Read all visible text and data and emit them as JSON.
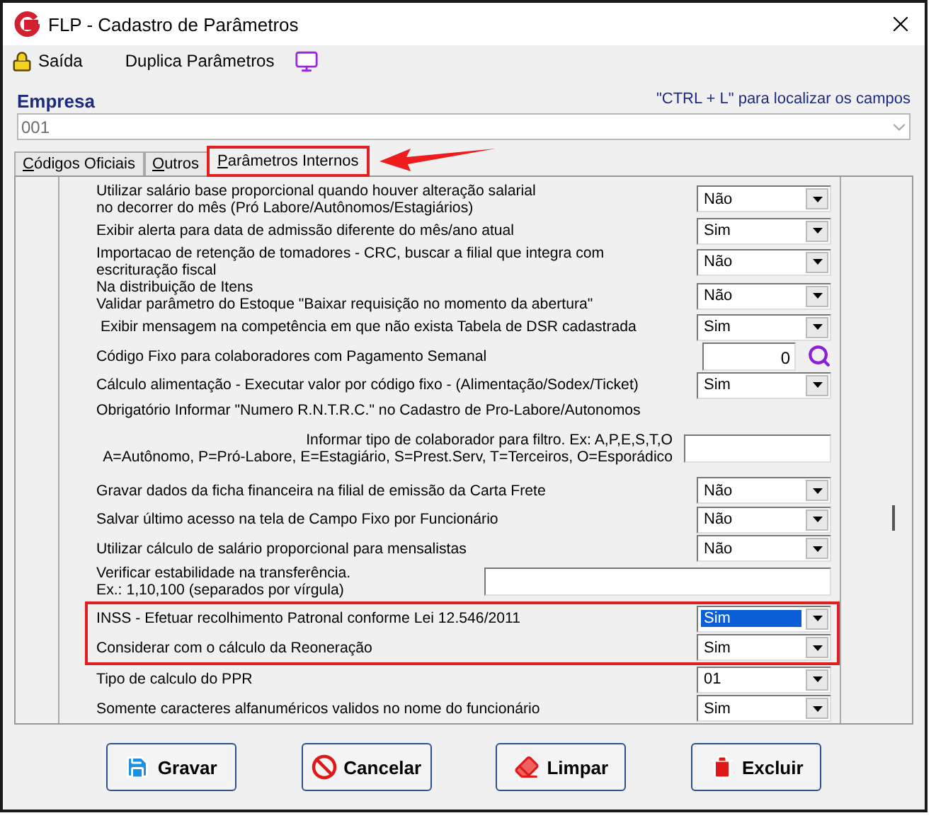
{
  "window": {
    "title": "FLP - Cadastro de Parâmetros"
  },
  "toolbar": [
    {
      "label": "Saída"
    },
    {
      "label": "Duplica Parâmetros"
    }
  ],
  "empresa": {
    "label": "Empresa",
    "hint": "\"CTRL + L\" para localizar os campos",
    "value": "001"
  },
  "tabs": [
    {
      "label": "Códigos Oficiais",
      "selected": false,
      "highlighted": false
    },
    {
      "label": "Outros",
      "selected": false,
      "highlighted": false
    },
    {
      "label": "Parâmetros Internos",
      "selected": true,
      "highlighted": true
    }
  ],
  "rows": [
    {
      "kind": "select",
      "label": "Utilizar salário base proporcional quando houver alteração salarial\nno decorrer do mês (Pró Labore/Autônomos/Estagiários)",
      "value": "Não",
      "focused": false,
      "boxed": false
    },
    {
      "kind": "select",
      "label": "Exibir alerta para data de admissão diferente do mês/ano atual",
      "value": "Sim",
      "focused": false,
      "boxed": false
    },
    {
      "kind": "select",
      "label": "Importacao de retenção de tomadores - CRC, buscar a filial que integra com\nescrituração fiscal",
      "value": "Não",
      "focused": false,
      "boxed": false
    },
    {
      "kind": "select",
      "label": "Na distribuição de Itens\nValidar parâmetro do Estoque \"Baixar requisição no momento da abertura\"",
      "value": "Não",
      "focused": false,
      "boxed": false
    },
    {
      "kind": "select",
      "label": " Exibir mensagem na competência em que não exista Tabela de DSR cadastrada",
      "value": "Sim",
      "focused": false,
      "boxed": false
    },
    {
      "kind": "lookup",
      "label": "Código Fixo para colaboradores com Pagamento Semanal",
      "value": "0",
      "boxed": false
    },
    {
      "kind": "select",
      "label": "Cálculo alimentação - Executar valor por código fixo - (Alimentação/Sodex/Ticket)",
      "value": "Sim",
      "focused": false,
      "boxed": false
    },
    {
      "kind": "label",
      "label": "Obrigatório Informar \"Numero R.N.T.R.C.\" no Cadastro de Pro-Labore/Autonomos",
      "boxed": false
    },
    {
      "kind": "short-text",
      "label": "Informar tipo de colaborador para filtro. Ex: A,P,E,S,T,O\nA=Autônomo, P=Pró-Labore, E=Estagiário, S=Prest.Serv, T=Terceiros, O=Esporádico",
      "boxed": false
    },
    {
      "kind": "select",
      "label": "Gravar dados da ficha financeira na filial de emissão da Carta Frete",
      "value": "Não",
      "focused": false,
      "boxed": false
    },
    {
      "kind": "select",
      "label": "Salvar último acesso na tela de Campo Fixo por Funcionário",
      "value": "Não",
      "focused": false,
      "boxed": false
    },
    {
      "kind": "select",
      "label": "Utilizar cálculo de salário proporcional para mensalistas",
      "value": "Não",
      "focused": false,
      "boxed": false
    },
    {
      "kind": "long-text",
      "label": "Verificar estabilidade na transferência.\nEx.: 1,10,100 (separados por vírgula)",
      "boxed": false
    },
    {
      "kind": "select",
      "label": "INSS - Efetuar recolhimento Patronal conforme Lei 12.546/2011",
      "value": "Sim",
      "focused": true,
      "boxed": true
    },
    {
      "kind": "select",
      "label": "Considerar com o cálculo da Reoneração",
      "value": "Sim",
      "focused": false,
      "boxed": true
    },
    {
      "kind": "select",
      "label": "Tipo de calculo do PPR",
      "value": "01",
      "focused": false,
      "boxed": false
    },
    {
      "kind": "select",
      "label": "Somente caracteres alfanuméricos validos no nome do funcionário",
      "value": "Sim",
      "focused": false,
      "boxed": false
    }
  ],
  "buttons": [
    {
      "label": "Gravar"
    },
    {
      "label": "Cancelar"
    },
    {
      "label": "Limpar"
    },
    {
      "label": "Excluir"
    }
  ]
}
